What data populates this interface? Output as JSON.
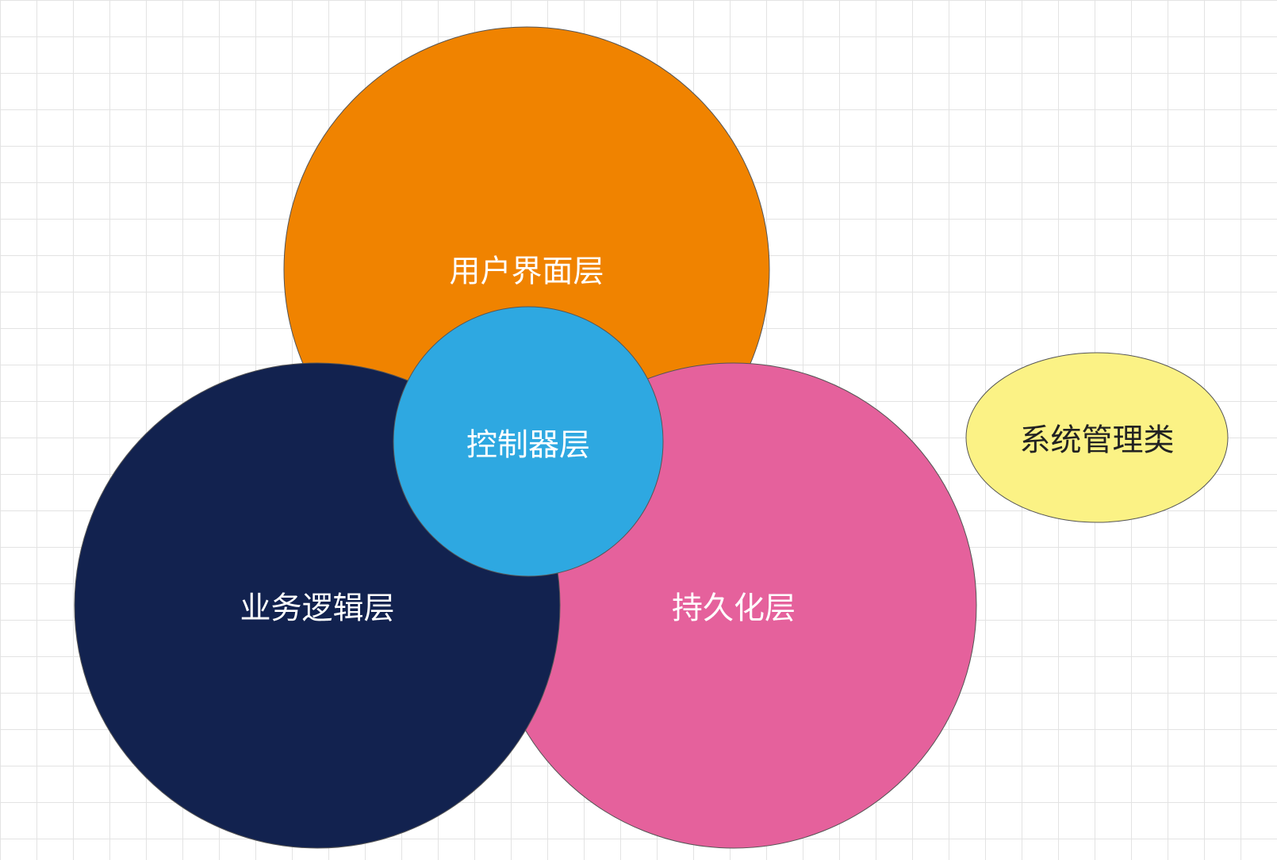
{
  "diagram": {
    "layers": {
      "ui": {
        "label": "用户界面层",
        "fill": "#f08300",
        "text_color": "#ffffff"
      },
      "business": {
        "label": "业务逻辑层",
        "fill": "#12224f",
        "text_color": "#ffffff"
      },
      "persistence": {
        "label": "持久化层",
        "fill": "#e5619c",
        "text_color": "#ffffff"
      },
      "controller": {
        "label": "控制器层",
        "fill": "#2ea8e1",
        "text_color": "#ffffff"
      },
      "system_mgmt": {
        "label": "系统管理类",
        "fill": "#fbf285",
        "text_color": "#222222"
      }
    }
  }
}
